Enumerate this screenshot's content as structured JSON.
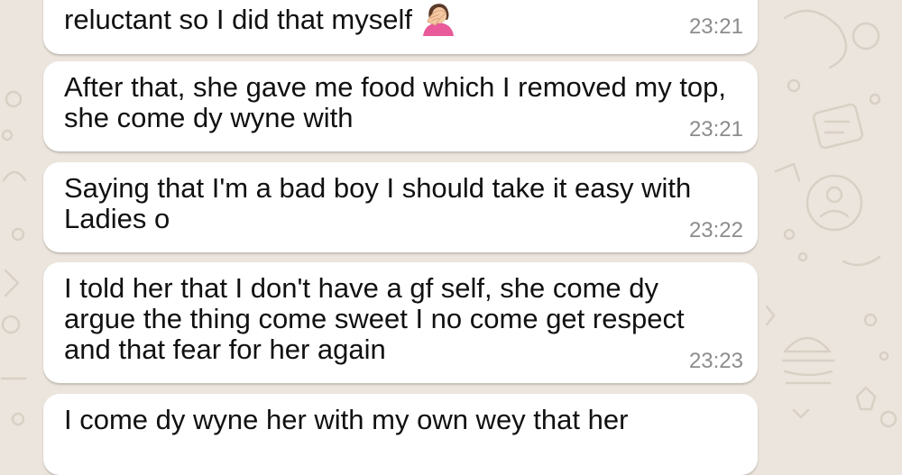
{
  "messages": [
    {
      "text": "reluctant so I did that myself",
      "time": "23:21",
      "emoji": "person-facepalming"
    },
    {
      "text": "After that, she gave me food which I removed my top, she come dy wyne with",
      "time": "23:21"
    },
    {
      "text": "Saying that I'm a bad boy I should take it easy with Ladies o",
      "time": "23:22"
    },
    {
      "text": "I told her that I don't have a gf self, she come dy argue the thing come sweet I no come get respect and that fear for her again",
      "time": "23:23"
    },
    {
      "text": "I come dy wyne her with my own wey that her",
      "time": ""
    }
  ],
  "colors": {
    "background": "#ece5dd",
    "bubble": "#ffffff",
    "text": "#111111",
    "timestamp": "#8c8c8c"
  }
}
